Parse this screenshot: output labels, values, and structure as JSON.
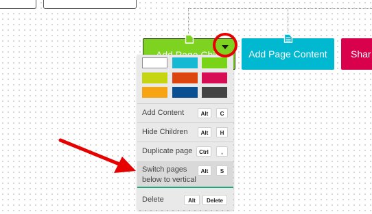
{
  "colors": {
    "accent_green": "#7ed321",
    "teal": "#00b9d1",
    "crimson": "#d9004c",
    "annotation_red": "#e60000",
    "swatches": [
      "#ffffff",
      "#17b8d3",
      "#79d316",
      "#c5d514",
      "#dd4510",
      "#d60d55",
      "#f6a412",
      "#0a4f91",
      "#434343"
    ]
  },
  "nodes": {
    "add_page_child": {
      "label": "Add Page Child",
      "icon": "page-icon"
    },
    "add_page_content": {
      "label": "Add Page Content",
      "icon": "document-icon"
    },
    "share": {
      "label": "Shar"
    }
  },
  "dropdown": {
    "icon": "caret-down-icon"
  },
  "menu": {
    "add_content": {
      "label": "Add Content",
      "keys": [
        "Alt",
        "C"
      ]
    },
    "hide_children": {
      "label": "Hide Children",
      "keys": [
        "Alt",
        "H"
      ]
    },
    "duplicate_page": {
      "label": "Duplicate page",
      "keys": [
        "Ctrl",
        ","
      ]
    },
    "switch_pages": {
      "label_line1": "Switch pages",
      "label_line2": "below to vertical",
      "keys": [
        "Alt",
        "S"
      ]
    },
    "delete": {
      "label": "Delete",
      "keys": [
        "Alt",
        "Delete"
      ]
    }
  },
  "annotations": {
    "circle": "highlight-circle",
    "arrow": "pointer-arrow"
  }
}
